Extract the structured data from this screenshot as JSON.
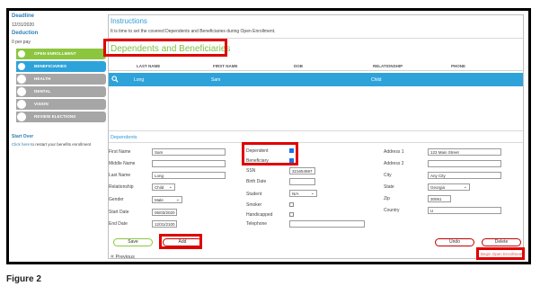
{
  "sidebar": {
    "deadline_title": "Deadline",
    "deadline_date": "12/31/2020",
    "deduction_title": "Deduction",
    "deduction_value": "0 per pay",
    "steps": [
      {
        "label": "OPEN ENROLLMENT",
        "state": "done"
      },
      {
        "label": "BENEFICIARIES",
        "state": "current"
      },
      {
        "label": "HEALTH",
        "state": "todo"
      },
      {
        "label": "DENTAL",
        "state": "todo"
      },
      {
        "label": "VISION",
        "state": "todo"
      },
      {
        "label": "REVIEW ELECTIONS",
        "state": "todo"
      }
    ],
    "start_over": "Start Over",
    "restart_link": "Click here",
    "restart_text": " to restart your benefits enrollment"
  },
  "instructions": {
    "title": "Instructions",
    "text": "It is time to set the covered Dependents and Beneficiaries during Open Enrollment."
  },
  "section_title": "Dependents and Beneficiaries",
  "table": {
    "headers": [
      "LAST NAME",
      "FIRST NAME",
      "DOB",
      "RELATIONSHIP",
      "PHONE"
    ],
    "rows": [
      {
        "last_name": "Long",
        "first_name": "Sam",
        "dob": "",
        "relationship": "Child",
        "phone": ""
      }
    ]
  },
  "dependents_title": "Dependents",
  "form": {
    "first_name_label": "First Name",
    "first_name": "Sam",
    "middle_name_label": "Middle Name",
    "middle_name": "",
    "last_name_label": "Last Name",
    "last_name": "Long",
    "relationship_label": "Relationship",
    "relationship": "Child",
    "gender_label": "Gender",
    "gender": "Male",
    "start_date_label": "Start Date",
    "start_date": "06/03/2020",
    "end_date_label": "End Date",
    "end_date": "12/31/2100",
    "dependent_label": "Dependent",
    "dependent_checked": true,
    "beneficiary_label": "Beneficiary",
    "beneficiary_checked": true,
    "ssn_label": "SSN",
    "ssn": "321654987",
    "birth_date_label": "Birth Date",
    "birth_date": "",
    "student_label": "Student",
    "student": "N/A",
    "smoker_label": "Smoker",
    "smoker_checked": false,
    "handicapped_label": "Handicapped",
    "handicapped_checked": false,
    "telephone_label": "Telephone",
    "telephone": "",
    "address1_label": "Address 1",
    "address1": "123 Main Street",
    "address2_label": "Address 2",
    "address2": "",
    "city_label": "City",
    "city": "Any City",
    "state_label": "State",
    "state": "Georgia",
    "zip_label": "Zip",
    "zip": "30061",
    "country_label": "Country",
    "country": "U"
  },
  "buttons": {
    "save": "Save",
    "add": "Add",
    "undo": "Undo",
    "delete": "Delete",
    "previous": "Previous",
    "begin": "Begin Open Enrollment"
  },
  "caption": "Figure 2",
  "colors": {
    "accent": "#2ea3da",
    "done": "#8cc63f",
    "todo": "#a6a6a6",
    "highlight": "#e00000",
    "section_title": "#7cc242"
  }
}
